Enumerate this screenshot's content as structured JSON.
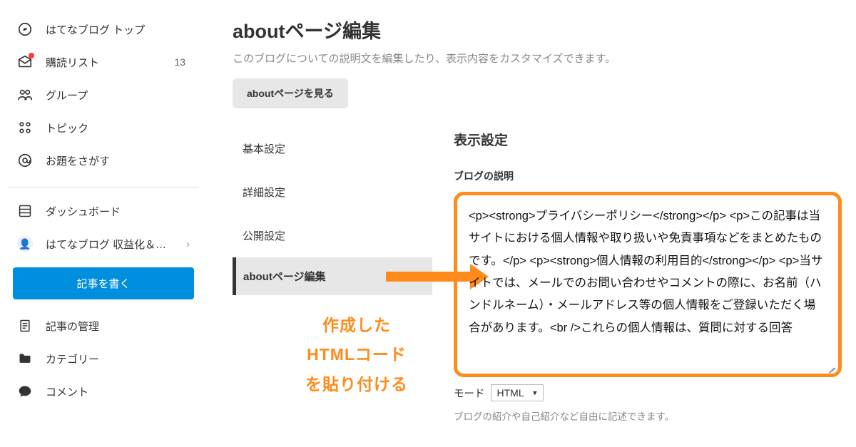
{
  "sidebar": {
    "top": {
      "label": "はてなブログ トップ"
    },
    "read": {
      "label": "購読リスト",
      "count": "13"
    },
    "group": {
      "label": "グループ"
    },
    "topic": {
      "label": "トピック"
    },
    "theme": {
      "label": "お題をさがす"
    },
    "dash": {
      "label": "ダッシュボード"
    },
    "monetize": {
      "label": "はてなブログ 収益化＆…"
    },
    "write": {
      "label": "記事を書く"
    },
    "manage": {
      "label": "記事の管理"
    },
    "category": {
      "label": "カテゴリー"
    },
    "comment": {
      "label": "コメント"
    }
  },
  "page": {
    "title": "aboutページ編集",
    "desc": "このブログについての説明文を編集したり、表示内容をカスタマイズできます。",
    "view_btn": "aboutページを見る"
  },
  "subnav": {
    "basic": "基本設定",
    "detail": "詳細設定",
    "publish": "公開設定",
    "about": "aboutページ編集"
  },
  "annotation": {
    "l1": "作成した",
    "l2": "HTMLコード",
    "l3": "を貼り付ける"
  },
  "panel": {
    "title": "表示設定",
    "field_label": "ブログの説明",
    "code": "<p><strong>プライバシーポリシー</strong></p> <p>この記事は当サイトにおける個人情報や取り扱いや免責事項などをまとめたものです。</p> <p><strong>個人情報の利用目的</strong></p> <p>当サイトでは、メールでのお問い合わせやコメントの際に、お名前（ハンドルネーム）・メールアドレス等の個人情報をご登録いただく場合があります。<br />これらの個人情報は、質問に対する回答",
    "mode_label": "モード",
    "mode_value": "HTML",
    "hint": "ブログの紹介や自己紹介など自由に記述できます。"
  }
}
